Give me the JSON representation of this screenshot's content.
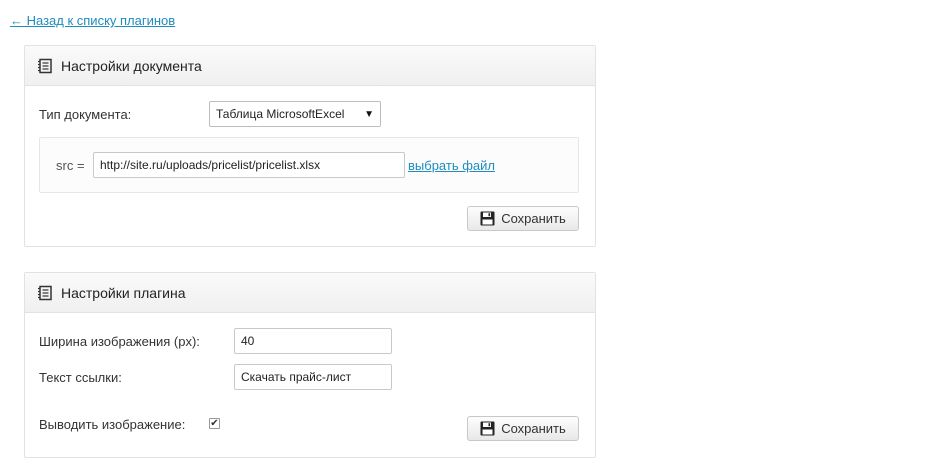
{
  "back_link": "← Назад к списку плагинов",
  "doc_settings": {
    "title": "Настройки документа",
    "icon": "book-icon",
    "doc_type_label": "Тип документа:",
    "doc_type_value": "Таблица MicrosoftExcel",
    "src_label": "src =",
    "src_value": "http://site.ru/uploads/pricelist/pricelist.xlsx",
    "pick_file": "выбрать файл",
    "save": "Сохранить"
  },
  "plugin_settings": {
    "title": "Настройки плагина",
    "icon": "book-icon",
    "width_label": "Ширина изображения (px):",
    "width_value": "40",
    "link_text_label": "Текст ссылки:",
    "link_text_value": "Скачать прайс-лист",
    "show_image_label": "Выводить изображение:",
    "show_image_checked": true,
    "save": "Сохранить"
  }
}
